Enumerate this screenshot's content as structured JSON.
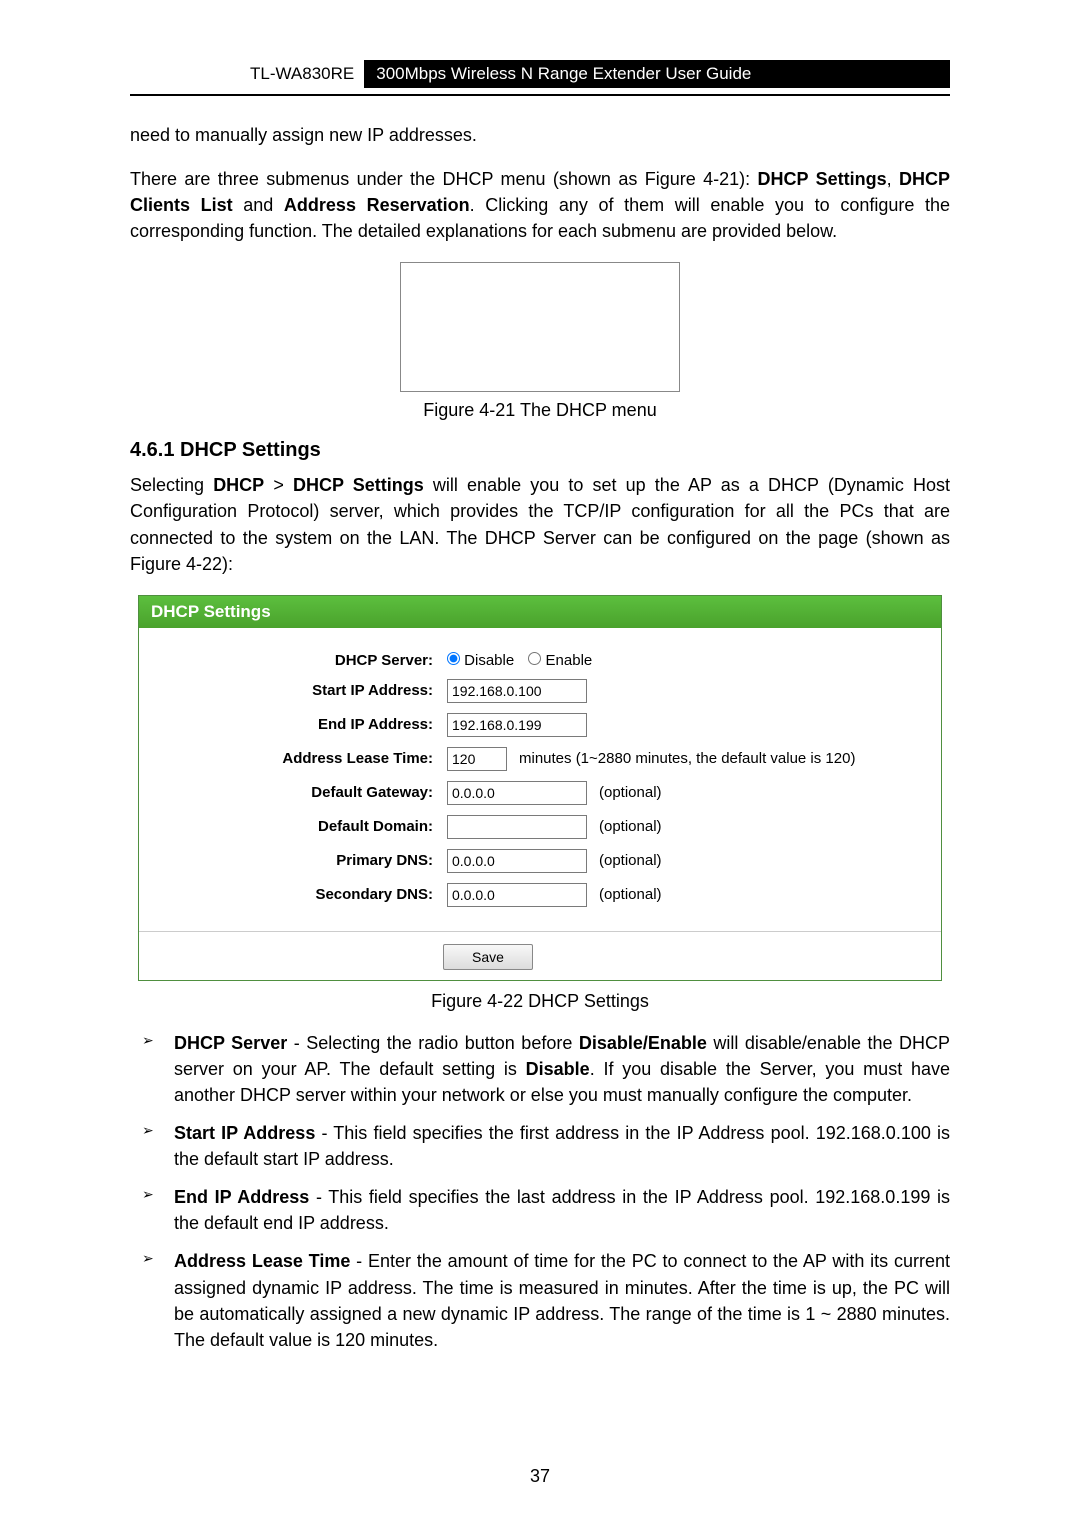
{
  "header": {
    "model": "TL-WA830RE",
    "title": "300Mbps Wireless N Range Extender User Guide"
  },
  "intro": {
    "line1": "need to manually assign new IP addresses.",
    "para1_a": "There are three submenus under the DHCP menu (shown as Figure 4-21): ",
    "para1_b": "DHCP Settings",
    "para1_c": ", ",
    "para1_d": "DHCP Clients List",
    "para1_e": " and ",
    "para1_f": "Address Reservation",
    "para1_g": ". Clicking any of them will enable you to configure the corresponding function. The detailed explanations for each submenu are provided below."
  },
  "fig21_caption": "Figure 4-21 The DHCP menu",
  "section_heading": "4.6.1  DHCP Settings",
  "section_para_a": "Selecting ",
  "section_para_b": "DHCP",
  "section_para_c": " > ",
  "section_para_d": "DHCP Settings",
  "section_para_e": " will enable you to set up the AP as a DHCP (Dynamic Host Configuration Protocol) server, which provides the TCP/IP configuration for all the PCs that are connected to the system on the LAN. The DHCP Server can be configured on the page (shown as Figure 4-22):",
  "panel": {
    "title": "DHCP Settings",
    "labels": {
      "dhcp_server": "DHCP Server:",
      "start_ip": "Start IP Address:",
      "end_ip": "End IP Address:",
      "lease": "Address Lease Time:",
      "gateway": "Default Gateway:",
      "domain": "Default Domain:",
      "pdns": "Primary DNS:",
      "sdns": "Secondary DNS:"
    },
    "radio": {
      "disable": "Disable",
      "enable": "Enable"
    },
    "values": {
      "start_ip": "192.168.0.100",
      "end_ip": "192.168.0.199",
      "lease": "120",
      "gateway": "0.0.0.0",
      "domain": "",
      "pdns": "0.0.0.0",
      "sdns": "0.0.0.0"
    },
    "hints": {
      "lease": "minutes (1~2880 minutes, the default value is 120)",
      "optional": "(optional)"
    },
    "save": "Save"
  },
  "fig22_caption": "Figure 4-22 DHCP Settings",
  "bullets": {
    "b1_a": "DHCP Server",
    "b1_b": " - Selecting the radio button before ",
    "b1_c": "Disable/Enable",
    "b1_d": " will disable/enable the DHCP server on your AP. The default setting is ",
    "b1_e": "Disable",
    "b1_f": ". If you disable the Server, you must have another DHCP server within your network or else you must manually configure the computer.",
    "b2_a": "Start IP Address",
    "b2_b": " - This field specifies the first address in the IP Address pool. 192.168.0.100 is the default start IP address.",
    "b3_a": "End IP Address",
    "b3_b": " - This field specifies the last address in the IP Address pool. 192.168.0.199 is the default end IP address.",
    "b4_a": "Address Lease Time",
    "b4_b": " - Enter the amount of time for the PC to connect to the AP with its current assigned dynamic IP address. The time is measured in minutes. After the time is up, the PC will be automatically assigned a new dynamic IP address. The range of the time is 1 ~ 2880 minutes. The default value is 120 minutes."
  },
  "page_number": "37"
}
